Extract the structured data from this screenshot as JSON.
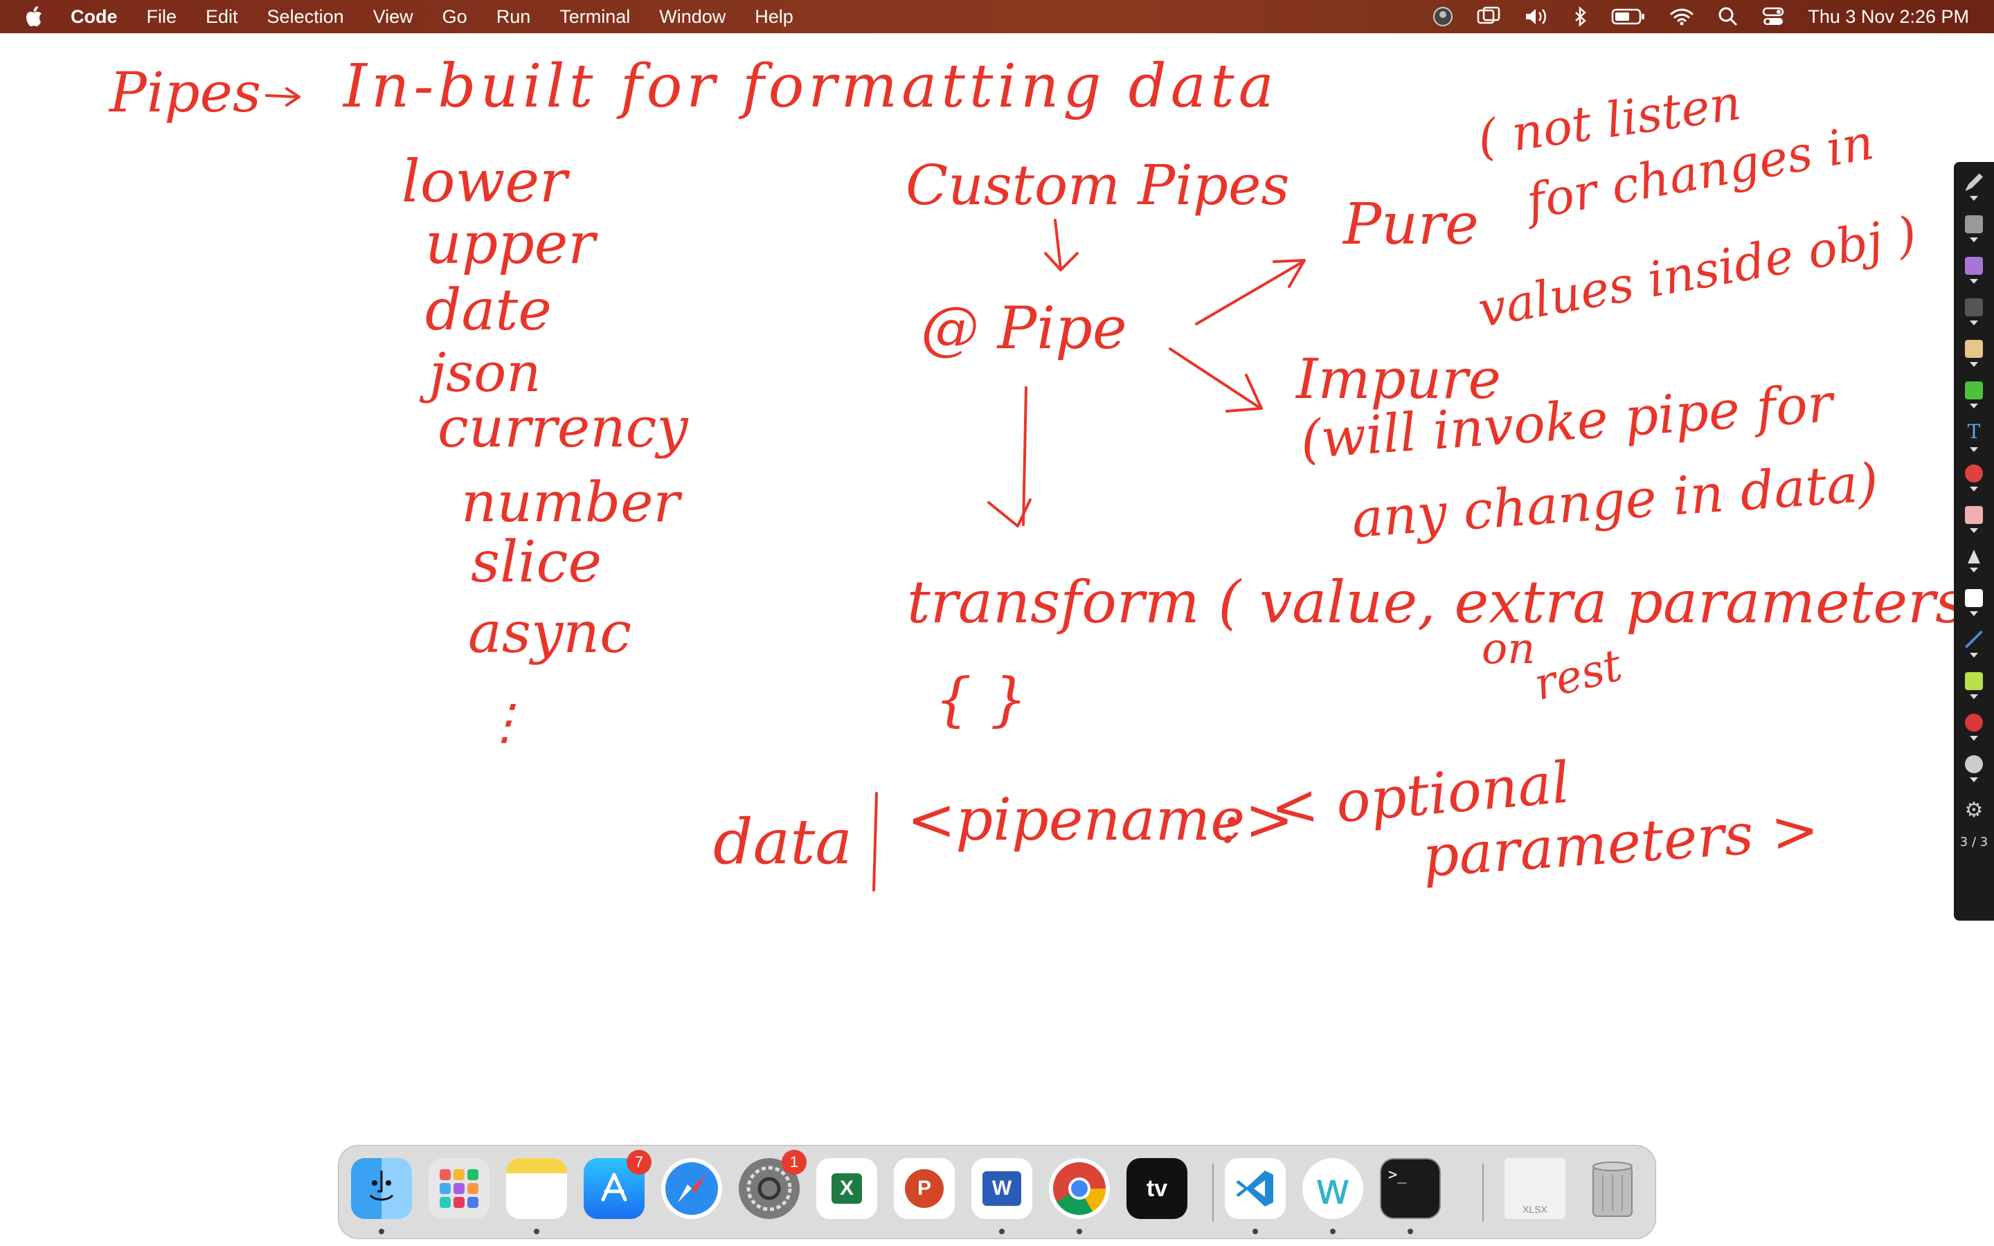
{
  "menubar": {
    "app_name": "Code",
    "items": [
      "File",
      "Edit",
      "Selection",
      "View",
      "Go",
      "Run",
      "Terminal",
      "Window",
      "Help"
    ],
    "clock": "Thu 3 Nov  2:26 PM",
    "status_icons": [
      "avatar-icon",
      "screen-mirror-icon",
      "volume-icon",
      "bluetooth-icon",
      "battery-icon",
      "wifi-icon",
      "spotlight-search-icon",
      "control-center-icon"
    ]
  },
  "notes": {
    "heading_left": "Pipes",
    "heading_arrow": "→",
    "heading_rest": "In-built for formatting data",
    "builtin_pipes": [
      "lower",
      "upper",
      "date",
      "json",
      "currency",
      "number",
      "slice",
      "async",
      "⋮"
    ],
    "custom_pipes": "Custom Pipes",
    "decorator": "@ Pipe",
    "pure": "Pure",
    "pure_note_line1": "( not listen",
    "pure_note_line2": "for changes in",
    "pure_note_line3": "values inside obj )",
    "impure": "Impure",
    "impure_note_line1": "(will invoke pipe for",
    "impure_note_line2": "any change in data)",
    "transform_call": "transform ( value, extra parameters)",
    "transform_sub": "on",
    "transform_sub2": "rest",
    "transform_body": "{     }",
    "syntax_data": "data",
    "syntax_pipe_char": "|",
    "syntax_pipename": "<pipename>",
    "syntax_colon": ":",
    "syntax_optional": "< optional",
    "syntax_parameters": "parameters >"
  },
  "annotation_toolbar": {
    "page_indicator": "3 / 3",
    "tools": [
      "pen-icon",
      "print-icon",
      "highlighter-icon",
      "marker-icon",
      "pencil-icon",
      "green-marker-icon",
      "text-tool-icon",
      "shapes-icon",
      "eraser-icon",
      "pointer-icon",
      "whiteboard-icon",
      "line-tool-icon",
      "rectangle-icon",
      "record-icon",
      "camera-icon",
      "settings-icon"
    ]
  },
  "dock": {
    "apps": [
      {
        "name": "Finder"
      },
      {
        "name": "Launchpad"
      },
      {
        "name": "Notes"
      },
      {
        "name": "App Store",
        "badge": "7"
      },
      {
        "name": "Safari"
      },
      {
        "name": "System Preferences",
        "badge": "1"
      },
      {
        "name": "Excel",
        "glyph": "X"
      },
      {
        "name": "PowerPoint",
        "glyph": "P"
      },
      {
        "name": "Word",
        "glyph": "W"
      },
      {
        "name": "Chrome"
      },
      {
        "name": "Apple TV",
        "glyph": "tv"
      },
      {
        "name": "Visual Studio Code"
      },
      {
        "name": "Webex",
        "glyph": "w"
      },
      {
        "name": "Terminal",
        "glyph": ">_"
      },
      {
        "name": "XLSX file",
        "glyph": "XLSX"
      },
      {
        "name": "Trash"
      }
    ]
  },
  "colors": {
    "ink": "#e8352a",
    "menubar": "#7a2a18",
    "toolbar": "#1b1b1b"
  }
}
